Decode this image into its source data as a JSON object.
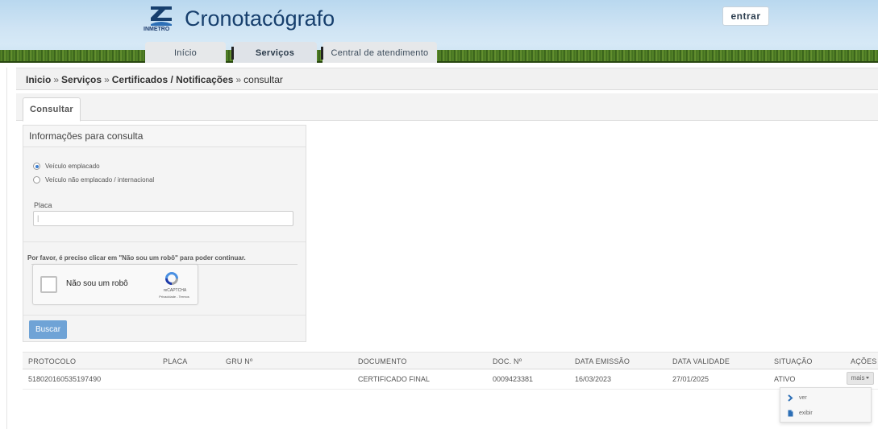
{
  "header": {
    "logo_text": "INMETRO",
    "app_title": "Cronotacógrafo",
    "login_label": "entrar",
    "nav_tabs": [
      {
        "label": "Início"
      },
      {
        "label": "Serviços"
      },
      {
        "label": "Central de atendimento"
      }
    ]
  },
  "breadcrumb": {
    "items": [
      "Inicio",
      "Serviços",
      "Certificados / Notificações"
    ],
    "current": "consultar",
    "separator": "»"
  },
  "tabs": {
    "active_label": "Consultar"
  },
  "form": {
    "panel_title": "Informações para consulta",
    "radio_options": [
      {
        "label": "Veículo emplacado",
        "selected": true
      },
      {
        "label": "Veículo não emplacado / internacional",
        "selected": false
      }
    ],
    "placa_label": "Placa",
    "placa_value": "",
    "robot_message": "Por favor, é preciso clicar em \"Não sou um robô\" para poder continuar.",
    "captcha_label": "Não sou um robô",
    "captcha_brand": "reCAPTCHA",
    "captcha_links": "Privacidade - Termos",
    "submit_label": "Buscar"
  },
  "table": {
    "headers": {
      "protocolo": "PROTOCOLO",
      "placa": "PLACA",
      "gru": "GRU Nº",
      "documento": "DOCUMENTO",
      "doc_n": "DOC. Nº",
      "data_emissao": "DATA EMISSÃO",
      "data_validade": "DATA VALIDADE",
      "situacao": "SITUAÇÃO",
      "acoes": "AÇÕES"
    },
    "rows": [
      {
        "protocolo": "518020160535197490",
        "placa": "",
        "gru": "",
        "documento": "CERTIFICADO FINAL",
        "doc_n": "0009423381",
        "data_emissao": "16/03/2023",
        "data_validade": "27/01/2025",
        "situacao": "ATIVO",
        "acoes_label": "mais"
      }
    ]
  },
  "actions_menu": {
    "items": [
      {
        "label": "ver",
        "icon": "chevron-right-icon"
      },
      {
        "label": "exibir",
        "icon": "document-icon"
      }
    ]
  },
  "colors": {
    "brand": "#173f6d",
    "button": "#6fa3d6",
    "radio_selected": "#3b7ed0"
  }
}
